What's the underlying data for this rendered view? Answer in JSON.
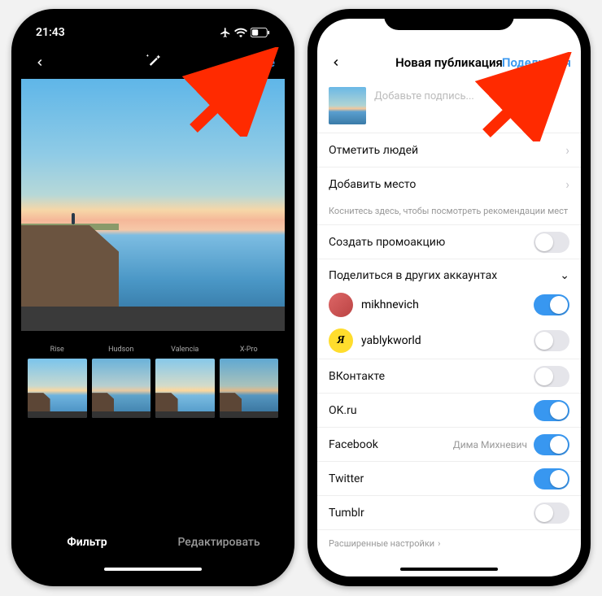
{
  "left": {
    "status_time": "21:43",
    "nav_next": "Далее",
    "filters": [
      {
        "name": "Rise",
        "class": "t-rise"
      },
      {
        "name": "Hudson",
        "class": "t-hudson"
      },
      {
        "name": "Valencia",
        "class": "t-valencia"
      },
      {
        "name": "X-Pro",
        "class": "t-xpro"
      }
    ],
    "tab_filter": "Фильтр",
    "tab_edit": "Редактировать"
  },
  "right": {
    "nav_title": "Новая публикация",
    "nav_share": "Поделиться",
    "caption_placeholder": "Добавьте подпись...",
    "row_tag_people": "Отметить людей",
    "row_add_location": "Добавить место",
    "location_hint": "Коснитесь здесь, чтобы посмотреть рекомендации мест",
    "row_promo": "Создать промоакцию",
    "section_other_accounts": "Поделиться в других аккаунтах",
    "accounts": [
      {
        "name": "mikhnevich",
        "on": true,
        "avatar": "av1",
        "initial": ""
      },
      {
        "name": "yablykworld",
        "on": false,
        "avatar": "av2",
        "initial": "Я"
      }
    ],
    "social": [
      {
        "name": "ВКонтакте",
        "sub": "",
        "on": false
      },
      {
        "name": "OK.ru",
        "sub": "",
        "on": true
      },
      {
        "name": "Facebook",
        "sub": "Дима Михневич",
        "on": true
      },
      {
        "name": "Twitter",
        "sub": "",
        "on": true
      },
      {
        "name": "Tumblr",
        "sub": "",
        "on": false
      }
    ],
    "advanced": "Расширенные настройки"
  }
}
